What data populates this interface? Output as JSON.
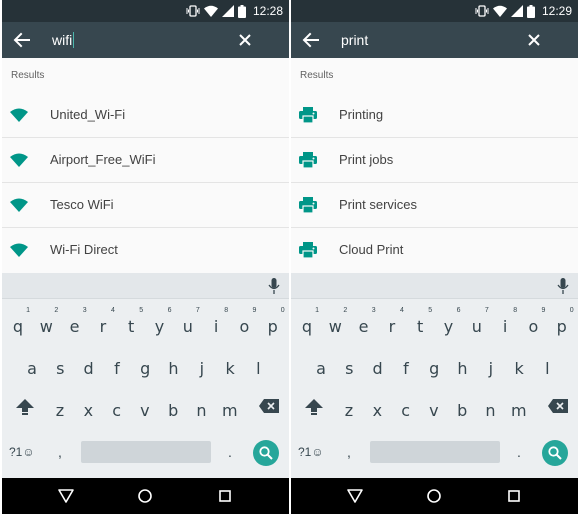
{
  "colors": {
    "status_bar": "#263238",
    "toolbar": "#37474f",
    "accent": "#009688",
    "key_text": "#37474f",
    "search_key": "#26a69a"
  },
  "icons": {
    "back": "arrow-left-icon",
    "clear": "close-icon",
    "mic": "mic-icon",
    "shift": "shift-icon",
    "backspace": "backspace-icon",
    "search": "search-icon",
    "wifi": "wifi-icon",
    "print": "printer-icon",
    "nav_back": "nav-back-triangle-icon",
    "nav_home": "nav-home-circle-icon",
    "nav_recent": "nav-recent-square-icon"
  },
  "screens": [
    {
      "status_time": "12:28",
      "query": "wifi",
      "results_header": "Results",
      "results": [
        {
          "label": "United_Wi-Fi",
          "icon": "wifi-icon"
        },
        {
          "label": "Airport_Free_WiFi",
          "icon": "wifi-icon"
        },
        {
          "label": "Tesco WiFi",
          "icon": "wifi-icon"
        },
        {
          "label": "Wi-Fi Direct",
          "icon": "wifi-icon"
        }
      ]
    },
    {
      "status_time": "12:29",
      "query": "print",
      "results_header": "Results",
      "results": [
        {
          "label": "Printing",
          "icon": "printer-icon"
        },
        {
          "label": "Print jobs",
          "icon": "printer-icon"
        },
        {
          "label": "Print services",
          "icon": "printer-icon"
        },
        {
          "label": "Cloud Print",
          "icon": "printer-icon"
        }
      ]
    }
  ],
  "keyboard": {
    "row1": [
      "q",
      "w",
      "e",
      "r",
      "t",
      "y",
      "u",
      "i",
      "o",
      "p"
    ],
    "row1_numbers": [
      "1",
      "2",
      "3",
      "4",
      "5",
      "6",
      "7",
      "8",
      "9",
      "0"
    ],
    "row2": [
      "a",
      "s",
      "d",
      "f",
      "g",
      "h",
      "j",
      "k",
      "l"
    ],
    "row3": [
      "z",
      "x",
      "c",
      "v",
      "b",
      "n",
      "m"
    ],
    "symbols_label": "?1☺",
    "comma_label": ",",
    "period_label": "."
  }
}
